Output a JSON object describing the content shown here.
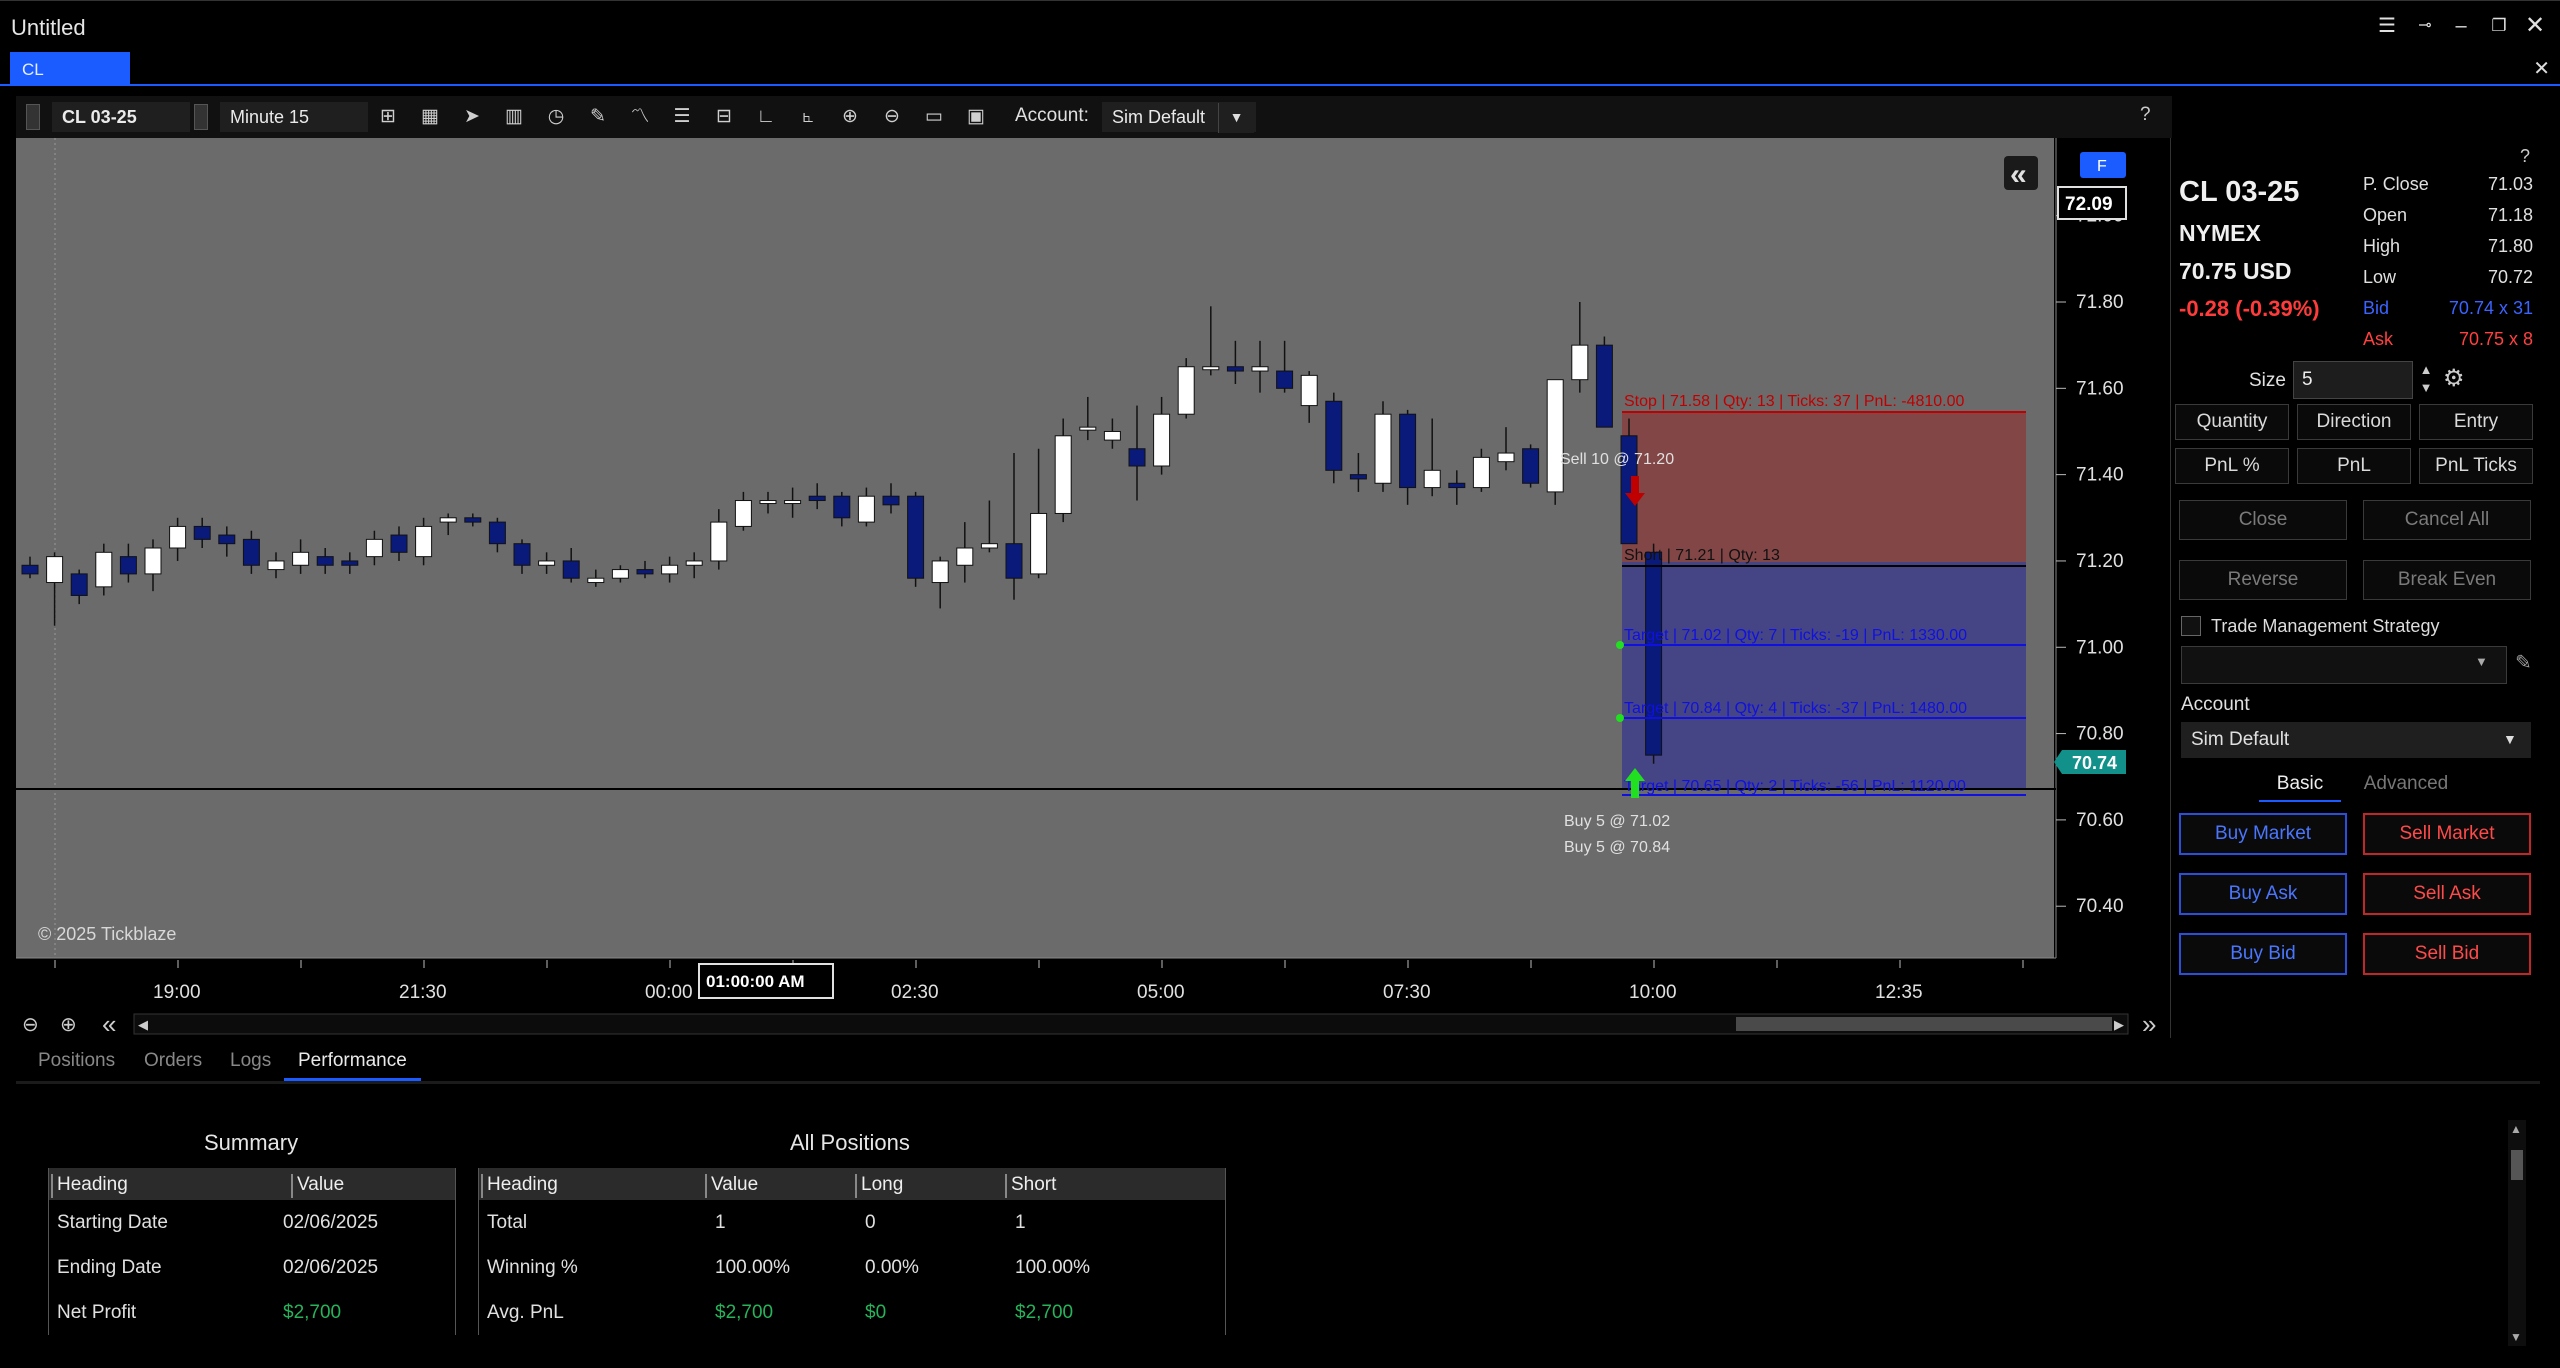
{
  "window": {
    "title": "Untitled"
  },
  "tab": {
    "label": "CL"
  },
  "toolbar": {
    "symbol": "CL 03-25",
    "interval": "Minute 15",
    "account_label": "Account:",
    "account_value": "Sim Default",
    "help": "?"
  },
  "chart": {
    "watermark": "© 2025 Tickblaze",
    "f_badge": "F",
    "collapse_icon": "«",
    "last_price_tag": "72.09",
    "bid_tag": "70.74",
    "crosshair_time": "01:00:00 AM",
    "price_ticks": [
      "72.00",
      "71.80",
      "71.60",
      "71.40",
      "71.20",
      "71.00",
      "70.80",
      "70.60",
      "70.40"
    ],
    "time_ticks": [
      "19:00",
      "21:30",
      "00:00",
      "02:30",
      "05:00",
      "07:30",
      "10:00",
      "12:35"
    ],
    "order_labels": {
      "stop": "Stop | 71.58 | Qty: 13 | Ticks: 37 | PnL: -4810.00",
      "position": "Short | 71.21 | Qty: 13",
      "target1": "Target | 71.02 | Qty: 7 | Ticks: -19 | PnL: 1330.00",
      "target2": "Target | 70.84 | Qty: 4 | Ticks: -37 | PnL: 1480.00",
      "target3": "Target | 70.65 | Qty: 2 | Ticks: -56 | PnL: 1120.00",
      "sell_fill": "Sell 10 @ 71.20",
      "buy_fill1": "Buy 5 @ 71.02",
      "buy_fill2": "Buy 5 @ 70.84"
    },
    "colors": {
      "background": "#6b6b6b",
      "bull": "#ffffff",
      "bear": "#0a1a7a",
      "stop": "#c00000",
      "target": "#1010e0"
    }
  },
  "chart_data": {
    "type": "candlestick",
    "title": "",
    "ylim": [
      70.28,
      72.18
    ],
    "y_ticks": [
      72.0,
      71.8,
      71.6,
      71.4,
      71.2,
      71.0,
      70.8,
      70.6,
      70.4
    ],
    "x_ticks": [
      "19:00",
      "21:30",
      "00:00",
      "02:30",
      "05:00",
      "07:30",
      "10:00",
      "12:35"
    ],
    "candles": [
      {
        "o": 71.19,
        "h": 71.21,
        "l": 71.16,
        "c": 71.17
      },
      {
        "o": 71.15,
        "h": 71.22,
        "l": 71.05,
        "c": 71.21
      },
      {
        "o": 71.17,
        "h": 71.18,
        "l": 71.1,
        "c": 71.12
      },
      {
        "o": 71.14,
        "h": 71.24,
        "l": 71.12,
        "c": 71.22
      },
      {
        "o": 71.21,
        "h": 71.24,
        "l": 71.15,
        "c": 71.17
      },
      {
        "o": 71.17,
        "h": 71.25,
        "l": 71.13,
        "c": 71.23
      },
      {
        "o": 71.23,
        "h": 71.3,
        "l": 71.2,
        "c": 71.28
      },
      {
        "o": 71.28,
        "h": 71.3,
        "l": 71.23,
        "c": 71.25
      },
      {
        "o": 71.26,
        "h": 71.28,
        "l": 71.21,
        "c": 71.24
      },
      {
        "o": 71.25,
        "h": 71.27,
        "l": 71.17,
        "c": 71.19
      },
      {
        "o": 71.18,
        "h": 71.22,
        "l": 71.16,
        "c": 71.2
      },
      {
        "o": 71.19,
        "h": 71.25,
        "l": 71.17,
        "c": 71.22
      },
      {
        "o": 71.21,
        "h": 71.23,
        "l": 71.17,
        "c": 71.19
      },
      {
        "o": 71.2,
        "h": 71.22,
        "l": 71.17,
        "c": 71.19
      },
      {
        "o": 71.21,
        "h": 71.27,
        "l": 71.19,
        "c": 71.25
      },
      {
        "o": 71.26,
        "h": 71.28,
        "l": 71.2,
        "c": 71.22
      },
      {
        "o": 71.21,
        "h": 71.3,
        "l": 71.19,
        "c": 71.28
      },
      {
        "o": 71.29,
        "h": 71.31,
        "l": 71.26,
        "c": 71.3
      },
      {
        "o": 71.3,
        "h": 71.31,
        "l": 71.28,
        "c": 71.29
      },
      {
        "o": 71.29,
        "h": 71.3,
        "l": 71.22,
        "c": 71.24
      },
      {
        "o": 71.24,
        "h": 71.25,
        "l": 71.17,
        "c": 71.19
      },
      {
        "o": 71.19,
        "h": 71.22,
        "l": 71.17,
        "c": 71.2
      },
      {
        "o": 71.2,
        "h": 71.23,
        "l": 71.15,
        "c": 71.16
      },
      {
        "o": 71.15,
        "h": 71.18,
        "l": 71.14,
        "c": 71.16
      },
      {
        "o": 71.16,
        "h": 71.19,
        "l": 71.15,
        "c": 71.18
      },
      {
        "o": 71.18,
        "h": 71.2,
        "l": 71.16,
        "c": 71.17
      },
      {
        "o": 71.17,
        "h": 71.21,
        "l": 71.15,
        "c": 71.19
      },
      {
        "o": 71.19,
        "h": 71.22,
        "l": 71.16,
        "c": 71.2
      },
      {
        "o": 71.2,
        "h": 71.32,
        "l": 71.18,
        "c": 71.29
      },
      {
        "o": 71.28,
        "h": 71.36,
        "l": 71.27,
        "c": 71.34
      },
      {
        "o": 71.34,
        "h": 71.36,
        "l": 71.31,
        "c": 71.34
      },
      {
        "o": 71.34,
        "h": 71.37,
        "l": 71.3,
        "c": 71.34
      },
      {
        "o": 71.35,
        "h": 71.38,
        "l": 71.32,
        "c": 71.34
      },
      {
        "o": 71.35,
        "h": 71.36,
        "l": 71.28,
        "c": 71.3
      },
      {
        "o": 71.29,
        "h": 71.37,
        "l": 71.28,
        "c": 71.35
      },
      {
        "o": 71.35,
        "h": 71.38,
        "l": 71.31,
        "c": 71.33
      },
      {
        "o": 71.35,
        "h": 71.36,
        "l": 71.14,
        "c": 71.16
      },
      {
        "o": 71.15,
        "h": 71.21,
        "l": 71.09,
        "c": 71.2
      },
      {
        "o": 71.19,
        "h": 71.29,
        "l": 71.15,
        "c": 71.23
      },
      {
        "o": 71.23,
        "h": 71.34,
        "l": 71.22,
        "c": 71.24
      },
      {
        "o": 71.24,
        "h": 71.45,
        "l": 71.11,
        "c": 71.16
      },
      {
        "o": 71.17,
        "h": 71.46,
        "l": 71.16,
        "c": 71.31
      },
      {
        "o": 71.31,
        "h": 71.53,
        "l": 71.29,
        "c": 71.49
      },
      {
        "o": 71.51,
        "h": 71.58,
        "l": 71.48,
        "c": 71.51
      },
      {
        "o": 71.48,
        "h": 71.53,
        "l": 71.46,
        "c": 71.5
      },
      {
        "o": 71.46,
        "h": 71.56,
        "l": 71.34,
        "c": 71.42
      },
      {
        "o": 71.42,
        "h": 71.58,
        "l": 71.4,
        "c": 71.54
      },
      {
        "o": 71.54,
        "h": 71.67,
        "l": 71.53,
        "c": 71.65
      },
      {
        "o": 71.65,
        "h": 71.79,
        "l": 71.63,
        "c": 71.65
      },
      {
        "o": 71.65,
        "h": 71.71,
        "l": 71.61,
        "c": 71.64
      },
      {
        "o": 71.64,
        "h": 71.71,
        "l": 71.59,
        "c": 71.65
      },
      {
        "o": 71.64,
        "h": 71.71,
        "l": 71.59,
        "c": 71.6
      },
      {
        "o": 71.56,
        "h": 71.64,
        "l": 71.52,
        "c": 71.63
      },
      {
        "o": 71.57,
        "h": 71.59,
        "l": 71.38,
        "c": 71.41
      },
      {
        "o": 71.4,
        "h": 71.45,
        "l": 71.36,
        "c": 71.39
      },
      {
        "o": 71.38,
        "h": 71.57,
        "l": 71.36,
        "c": 71.54
      },
      {
        "o": 71.54,
        "h": 71.55,
        "l": 71.33,
        "c": 71.37
      },
      {
        "o": 71.37,
        "h": 71.53,
        "l": 71.35,
        "c": 71.41
      },
      {
        "o": 71.38,
        "h": 71.41,
        "l": 71.33,
        "c": 71.37
      },
      {
        "o": 71.37,
        "h": 71.46,
        "l": 71.36,
        "c": 71.44
      },
      {
        "o": 71.43,
        "h": 71.51,
        "l": 71.41,
        "c": 71.45
      },
      {
        "o": 71.46,
        "h": 71.47,
        "l": 71.37,
        "c": 71.38
      },
      {
        "o": 71.36,
        "h": 71.57,
        "l": 71.33,
        "c": 71.62
      },
      {
        "o": 71.62,
        "h": 71.8,
        "l": 71.59,
        "c": 71.7
      },
      {
        "o": 71.7,
        "h": 71.72,
        "l": 71.53,
        "c": 71.51
      },
      {
        "o": 71.49,
        "h": 71.53,
        "l": 71.29,
        "c": 71.24
      },
      {
        "o": 71.22,
        "h": 71.24,
        "l": 70.73,
        "c": 70.75
      }
    ]
  },
  "instrument": {
    "help": "?",
    "symbol": "CL 03-25",
    "exchange": "NYMEX",
    "last": "70.75 USD",
    "change": "-0.28 (-0.39%)",
    "stats": [
      {
        "k": "P. Close",
        "v": "71.03",
        "color": "#e0e0e0"
      },
      {
        "k": "Open",
        "v": "71.18",
        "color": "#e0e0e0"
      },
      {
        "k": "High",
        "v": "71.80",
        "color": "#e0e0e0"
      },
      {
        "k": "Low",
        "v": "70.72",
        "color": "#e0e0e0"
      },
      {
        "k": "Bid",
        "v": "70.74 x 31",
        "color": "#3b63ff"
      },
      {
        "k": "Ask",
        "v": "70.75 x 8",
        "color": "#ff4040"
      }
    ]
  },
  "order_entry": {
    "size_label": "Size",
    "size_value": "5",
    "col_buttons": [
      "Quantity",
      "Direction",
      "Entry",
      "PnL %",
      "PnL",
      "PnL Ticks"
    ],
    "close": "Close",
    "cancel_all": "Cancel All",
    "reverse": "Reverse",
    "break_even": "Break Even",
    "tms_label": "Trade Management Strategy",
    "account_label": "Account",
    "account_value": "Sim Default",
    "tab_basic": "Basic",
    "tab_advanced": "Advanced",
    "buy_market": "Buy Market",
    "sell_market": "Sell Market",
    "buy_ask": "Buy Ask",
    "sell_ask": "Sell Ask",
    "buy_bid": "Buy Bid",
    "sell_bid": "Sell Bid"
  },
  "bottom": {
    "tabs": [
      "Positions",
      "Orders",
      "Logs",
      "Performance"
    ],
    "summary": {
      "title": "Summary",
      "headers": [
        "Heading",
        "Value"
      ],
      "rows": [
        [
          "Starting Date",
          "02/06/2025"
        ],
        [
          "Ending Date",
          "02/06/2025"
        ],
        [
          "Net Profit",
          "$2,700"
        ]
      ]
    },
    "all_positions": {
      "title": "All Positions",
      "headers": [
        "Heading",
        "Value",
        "Long",
        "Short"
      ],
      "rows": [
        [
          "Total",
          "1",
          "0",
          "1"
        ],
        [
          "Winning %",
          "100.00%",
          "0.00%",
          "100.00%"
        ],
        [
          "Avg. PnL",
          "$2,700",
          "$0",
          "$2,700"
        ]
      ]
    }
  }
}
